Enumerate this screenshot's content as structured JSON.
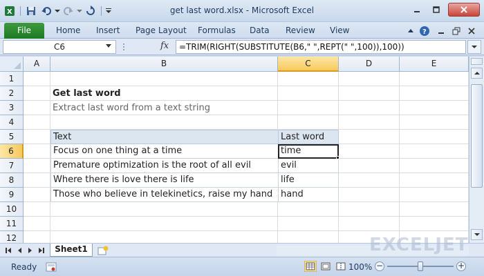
{
  "window": {
    "title": "get last word.xlsx - Microsoft Excel"
  },
  "ribbon": {
    "file_label": "File",
    "tabs": [
      "Home",
      "Insert",
      "Page Layout",
      "Formulas",
      "Data",
      "Review",
      "View"
    ]
  },
  "formula_bar": {
    "name_box": "C6",
    "fx_label": "fx",
    "formula": "=TRIM(RIGHT(SUBSTITUTE(B6,\" \",REPT(\" \",100)),100))"
  },
  "grid": {
    "columns": [
      "A",
      "B",
      "C",
      "D",
      "E"
    ],
    "rows": [
      "1",
      "2",
      "3",
      "4",
      "5",
      "6",
      "7",
      "8",
      "9",
      "10",
      "11",
      "12"
    ],
    "active_column": "C",
    "active_row": "6"
  },
  "sheet": {
    "title": "Get last word",
    "subtitle": "Extract last word from a text string",
    "table": {
      "headers": [
        "Text",
        "Last word"
      ],
      "rows": [
        [
          "Focus on one thing at a time",
          "time"
        ],
        [
          "Premature optimization is the root of all evil",
          "evil"
        ],
        [
          "Where there is love there is life",
          "life"
        ],
        [
          "Those who believe in telekinetics, raise my hand",
          "hand"
        ]
      ]
    }
  },
  "sheet_tabs": {
    "active": "Sheet1"
  },
  "watermark": "EXCELJET",
  "status_bar": {
    "status": "Ready",
    "zoom": "100%",
    "zoom_level_percent": 100
  },
  "colors": {
    "file_tab": "#1e7a23",
    "header_fill": "#dce6f1",
    "active_header": "#f8c95c"
  }
}
